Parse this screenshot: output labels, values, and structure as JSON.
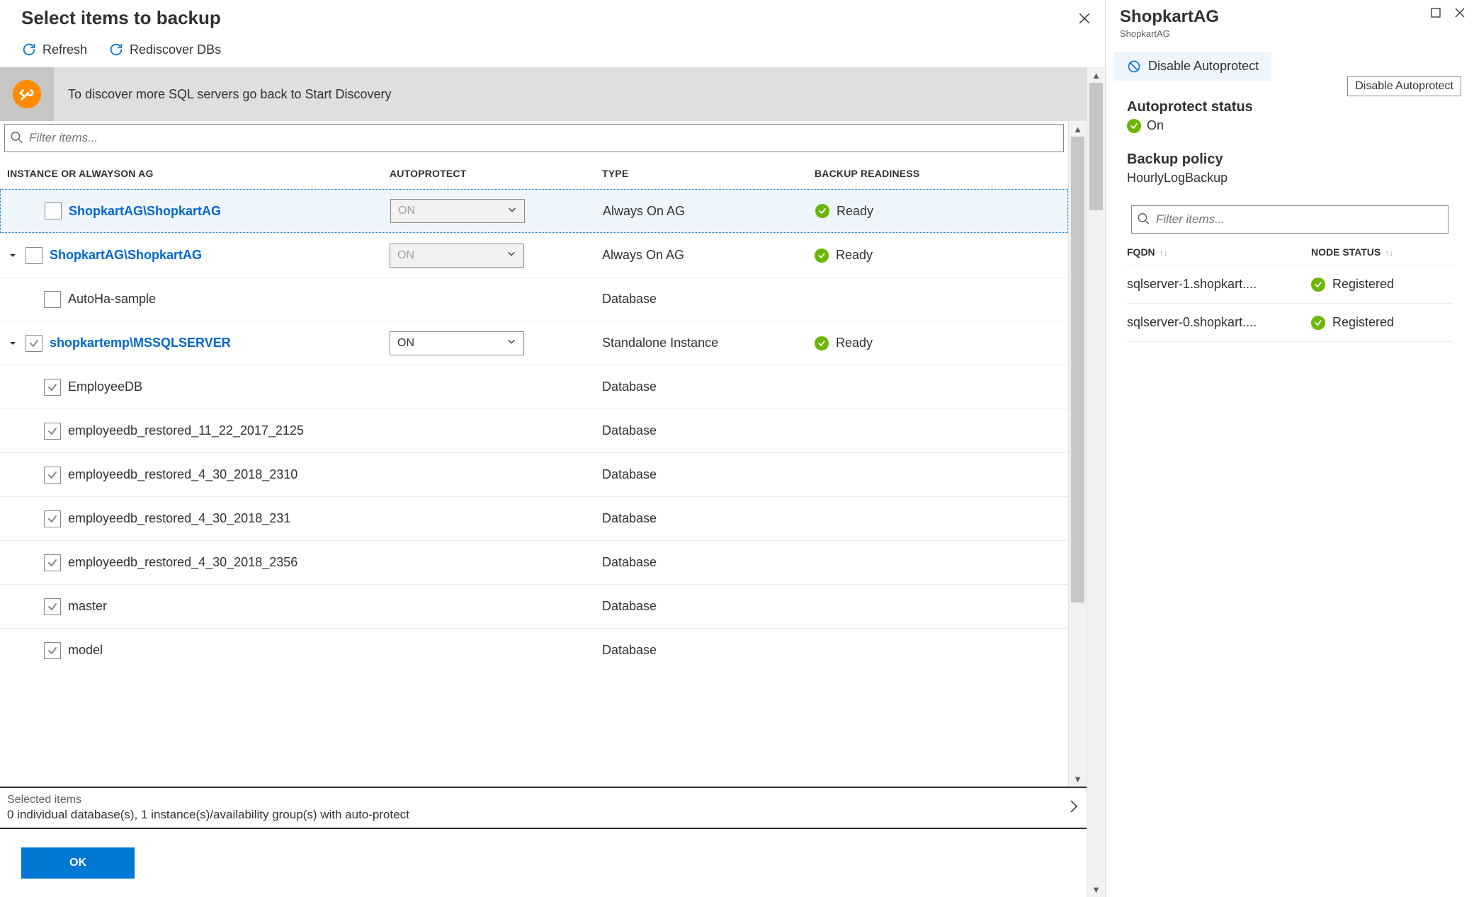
{
  "left": {
    "title": "Select items to backup",
    "toolbar": {
      "refresh": "Refresh",
      "rediscover": "Rediscover DBs"
    },
    "banner": "To discover more SQL servers go back to Start Discovery",
    "filter_placeholder": "Filter items...",
    "headers": {
      "instance": "INSTANCE OR ALWAYSON AG",
      "autoprotect": "AUTOPROTECT",
      "type": "TYPE",
      "readiness": "BACKUP READINESS"
    },
    "autoprotect_value": "ON",
    "ready_label": "Ready",
    "rows": [
      {
        "name": "ShopkartAG\\ShopkartAG",
        "link": true,
        "caret": false,
        "checked": false,
        "auto": "disabled",
        "type": "Always On AG",
        "ready": true,
        "highlight": true,
        "indent": 1
      },
      {
        "name": "ShopkartAG\\ShopkartAG",
        "link": true,
        "caret": true,
        "checked": false,
        "auto": "disabled",
        "type": "Always On AG",
        "ready": true,
        "indent": 0
      },
      {
        "name": "AutoHa-sample",
        "link": false,
        "caret": false,
        "checked": false,
        "auto": "none",
        "type": "Database",
        "indent": 2
      },
      {
        "name": "shopkartemp\\MSSQLSERVER",
        "link": true,
        "caret": true,
        "checked": true,
        "auto": "enabled",
        "type": "Standalone Instance",
        "ready": true,
        "indent": 0
      },
      {
        "name": "EmployeeDB",
        "link": false,
        "checked": true,
        "auto": "none",
        "type": "Database",
        "indent": 2
      },
      {
        "name": "employeedb_restored_11_22_2017_2125",
        "link": false,
        "checked": true,
        "auto": "none",
        "type": "Database",
        "indent": 2
      },
      {
        "name": "employeedb_restored_4_30_2018_2310",
        "link": false,
        "checked": true,
        "auto": "none",
        "type": "Database",
        "indent": 2
      },
      {
        "name": "employeedb_restored_4_30_2018_231",
        "link": false,
        "checked": true,
        "auto": "none",
        "type": "Database",
        "indent": 2
      },
      {
        "name": "employeedb_restored_4_30_2018_2356",
        "link": false,
        "checked": true,
        "auto": "none",
        "type": "Database",
        "indent": 2
      },
      {
        "name": "master",
        "link": false,
        "checked": true,
        "auto": "none",
        "type": "Database",
        "indent": 2
      },
      {
        "name": "model",
        "link": false,
        "checked": true,
        "auto": "none",
        "type": "Database",
        "indent": 2
      }
    ],
    "footer": {
      "label": "Selected items",
      "summary": "0 individual database(s), 1 instance(s)/availability group(s) with auto-protect"
    },
    "ok": "OK"
  },
  "right": {
    "title": "ShopkartAG",
    "subtitle": "ShopkartAG",
    "disable_btn": "Disable Autoprotect",
    "tooltip": "Disable Autoprotect",
    "status_label": "Autoprotect status",
    "status_value": "On",
    "policy_label": "Backup policy",
    "policy_value": "HourlyLogBackup",
    "filter_placeholder": "Filter items...",
    "headers": {
      "fqdn": "FQDN",
      "node_status": "NODE STATUS"
    },
    "nodes": [
      {
        "fqdn": "sqlserver-1.shopkart....",
        "status": "Registered"
      },
      {
        "fqdn": "sqlserver-0.shopkart....",
        "status": "Registered"
      }
    ]
  }
}
